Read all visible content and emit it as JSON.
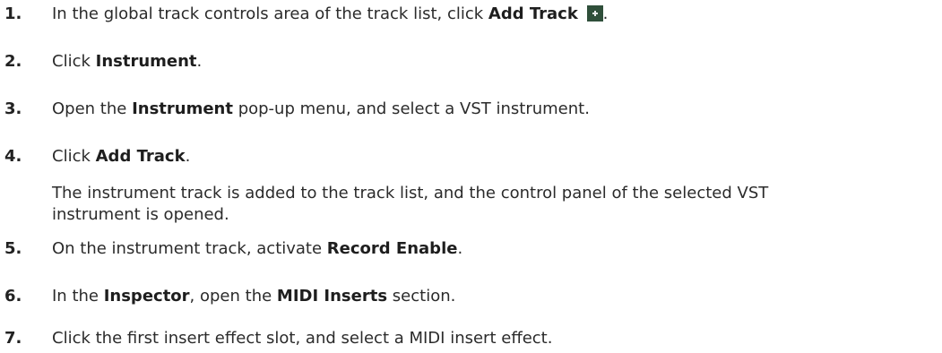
{
  "steps": [
    {
      "num": "1.",
      "pre": "In the global track controls area of the track list, click ",
      "bold": "Add Track",
      "post": "."
    },
    {
      "num": "2.",
      "pre": "Click ",
      "bold": "Instrument",
      "post": "."
    },
    {
      "num": "3.",
      "pre": "Open the ",
      "bold": "Instrument",
      "post": " pop-up menu, and select a VST instrument."
    },
    {
      "num": "4.",
      "pre": "Click ",
      "bold": "Add Track",
      "post": ".",
      "note_line1": "The instrument track is added to the track list, and the control panel of the selected VST",
      "note_line2": "instrument is opened."
    },
    {
      "num": "5.",
      "pre": "On the instrument track, activate ",
      "bold": "Record Enable",
      "post": "."
    },
    {
      "num": "6.",
      "pre": "In the ",
      "bold": "Inspector",
      "mid": ", open the ",
      "bold2": "MIDI Inserts",
      "post": " section."
    },
    {
      "num": "7.",
      "text": "Click the first insert effect slot, and select a MIDI insert effect."
    }
  ],
  "icons": {
    "add_track": "add-track-icon"
  }
}
